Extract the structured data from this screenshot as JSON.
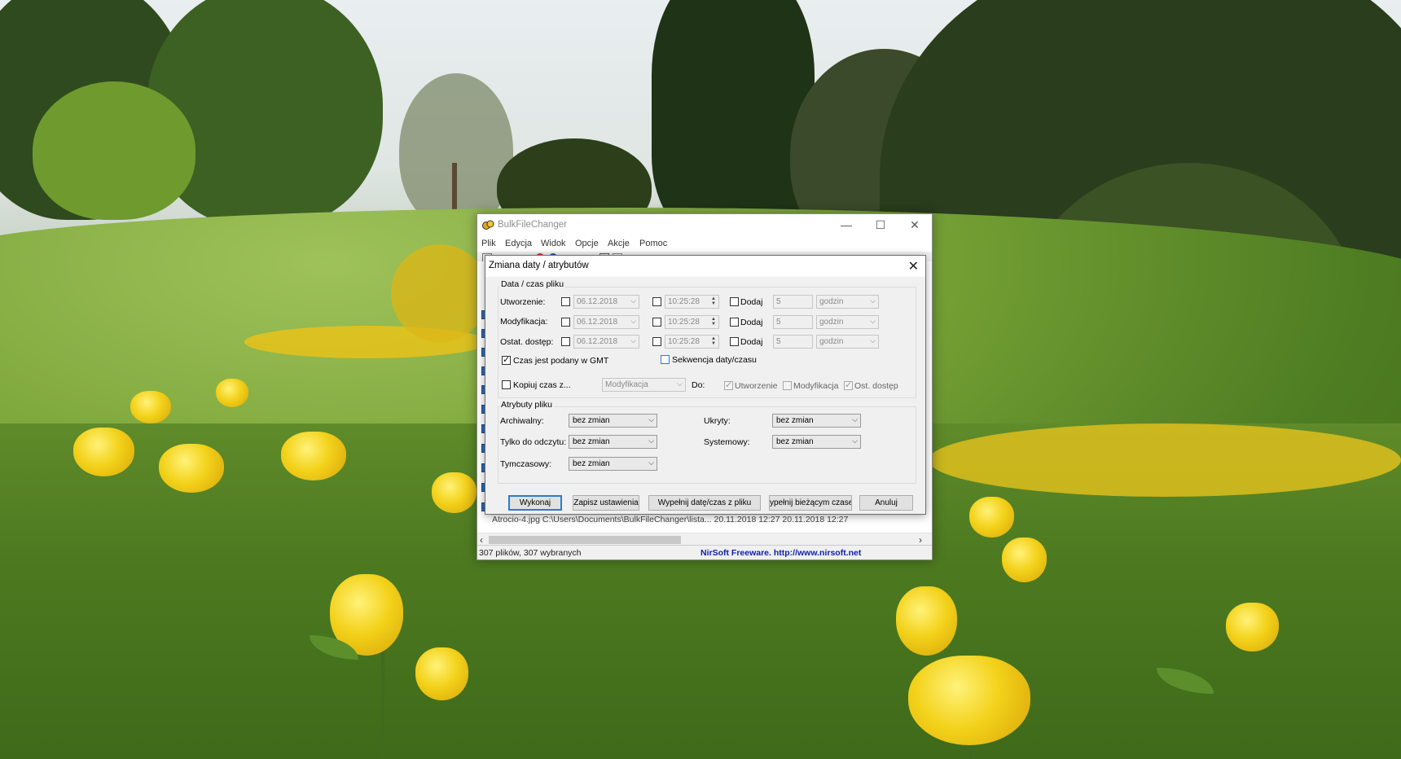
{
  "window": {
    "title": "BulkFileChanger",
    "controls": {
      "minimize": "—",
      "maximize": "☐",
      "close": "✕"
    }
  },
  "menu": [
    "Plik",
    "Edycja",
    "Widok",
    "Opcje",
    "Akcje",
    "Pomoc"
  ],
  "list": {
    "partial_row": "Atrocio-4.jpg          C:\\Users\\Documents\\BulkFileChanger\\lista...       20.11.2018 12:27       20.11.2018 12:27"
  },
  "statusbar": {
    "left": "307 plików, 307 wybranych",
    "right": "NirSoft Freeware.  http://www.nirsoft.net"
  },
  "dialog": {
    "title": "Zmiana daty / atrybutów",
    "close": "✕",
    "datetime_group": {
      "label": "Data / czas pliku",
      "rows": [
        {
          "label": "Utworzenie:",
          "date": "06.12.2018",
          "time": "10:25:28",
          "add_label": "Dodaj",
          "amount": "5",
          "unit": "godzin"
        },
        {
          "label": "Modyfikacja:",
          "date": "06.12.2018",
          "time": "10:25:28",
          "add_label": "Dodaj",
          "amount": "5",
          "unit": "godzin"
        },
        {
          "label": "Ostat. dostęp:",
          "date": "06.12.2018",
          "time": "10:25:28",
          "add_label": "Dodaj",
          "amount": "5",
          "unit": "godzin"
        }
      ],
      "gmt_label": "Czas jest podany w GMT",
      "gmt_checked": true,
      "sequence_label": "Sekwencja daty/czasu",
      "sequence_checked": false,
      "copy_label": "Kopiuj czas z...",
      "copy_source": "Modyfikacja",
      "to_label": "Do:",
      "targets": [
        {
          "label": "Utworzenie",
          "checked": true
        },
        {
          "label": "Modyfikacja",
          "checked": false
        },
        {
          "label": "Ost. dostęp",
          "checked": true
        }
      ]
    },
    "attributes_group": {
      "label": "Atrybuty pliku",
      "archive_label": "Archiwalny:",
      "archive_value": "bez zmian",
      "readonly_label": "Tylko do odczytu:",
      "readonly_value": "bez zmian",
      "temporary_label": "Tymczasowy:",
      "temporary_value": "bez zmian",
      "hidden_label": "Ukryty:",
      "hidden_value": "bez zmian",
      "system_label": "Systemowy:",
      "system_value": "bez zmian"
    },
    "buttons": {
      "execute": "Wykonaj",
      "save_settings": "Zapisz ustawienia",
      "fill_from_file": "Wypełnij datę/czas z pliku",
      "fill_current": "ypełnij bieżącym czase",
      "cancel": "Anuluj"
    }
  },
  "colors": {
    "accent": "#2a7bd5",
    "status_link": "#1020b0",
    "window_bg": "#f0f0f0"
  }
}
